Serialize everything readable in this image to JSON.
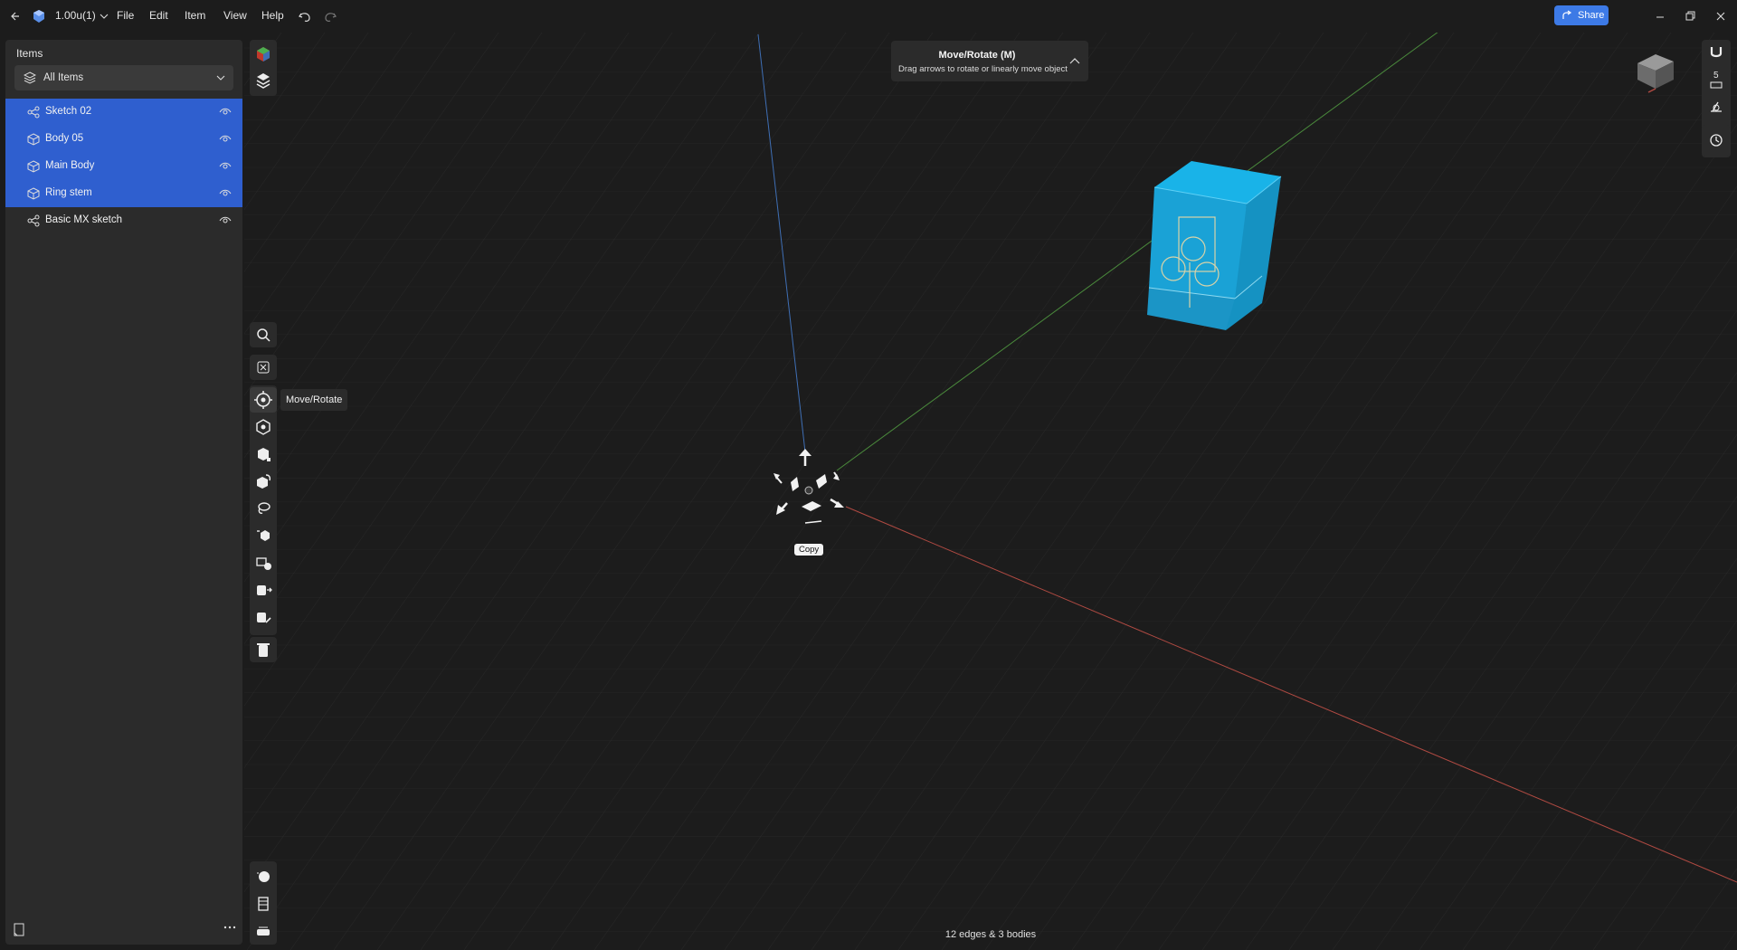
{
  "titlebar": {
    "version_label": "1.00u(1)",
    "menu": [
      "File",
      "Edit",
      "Item",
      "View",
      "Help"
    ],
    "share_label": "Share"
  },
  "panel": {
    "title": "Items",
    "filter_label": "All Items",
    "items": [
      {
        "label": "Sketch 02",
        "type": "sketch",
        "selected": true
      },
      {
        "label": "Body 05",
        "type": "body",
        "selected": true
      },
      {
        "label": "Main Body",
        "type": "body",
        "selected": true
      },
      {
        "label": "Ring stem",
        "type": "body",
        "selected": true
      },
      {
        "label": "Basic MX sketch",
        "type": "sketch",
        "selected": false
      }
    ]
  },
  "tooltip": {
    "move_rotate": "Move/Rotate"
  },
  "hint": {
    "title": "Move/Rotate (M)",
    "text": "Drag arrows to rotate or linearly move object"
  },
  "gizmo": {
    "copy_label": "Copy"
  },
  "status": {
    "text": "12 edges & 3 bodies"
  },
  "right_strip": {
    "snap_value": "5"
  },
  "colors": {
    "background": "#1c1c1c",
    "panel": "#2b2b2b",
    "selection": "#2f5fcf",
    "accent": "#3d7ae6",
    "model": "#1aa7d8",
    "axis_x": "#b04a42",
    "axis_y": "#4a8a3c",
    "axis_z": "#3f6fb5"
  }
}
